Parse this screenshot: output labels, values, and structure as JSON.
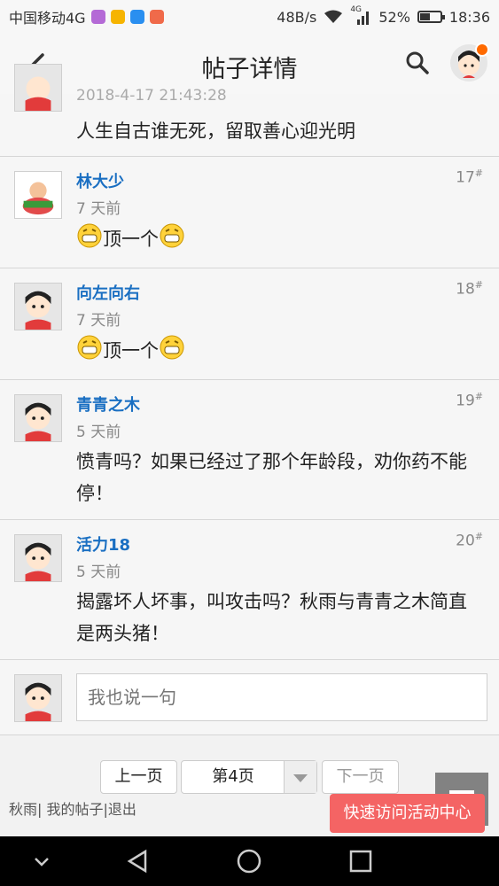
{
  "status_bar": {
    "carrier": "中国移动4G",
    "network_speed": "48B/s",
    "signal_label": "4G",
    "battery": "52%",
    "battery_level": 0.52,
    "time": "18:36"
  },
  "header": {
    "title": "帖子详情"
  },
  "posts": [
    {
      "time": "2018-4-17 21:43:28",
      "content": "人生自古谁无死，留取善心迎光明"
    },
    {
      "name": "林大少",
      "floor": "17",
      "time": "7 天前",
      "content": "顶一个"
    },
    {
      "name": "向左向右",
      "floor": "18",
      "time": "7 天前",
      "content": "顶一个"
    },
    {
      "name": "青青之木",
      "floor": "19",
      "time": "5 天前",
      "content": "愤青吗？如果已经过了那个年龄段，劝你药不能停！"
    },
    {
      "name": "活力18",
      "floor": "20",
      "time": "5 天前",
      "content": "揭露坏人坏事，叫攻击吗？秋雨与青青之木简直是两头猪！"
    }
  ],
  "floor_mark": "#",
  "reply": {
    "placeholder": "我也说一句"
  },
  "pagination": {
    "prev": "上一页",
    "current": "第4页",
    "next": "下一页"
  },
  "footer": {
    "links": "秋雨| 我的帖子|退出",
    "quick_access": "快速访问活动中心"
  },
  "colors": {
    "username": "#1a6fc2",
    "quick_access_bg": "#f46464",
    "notification_dot": "#ff6a00"
  }
}
